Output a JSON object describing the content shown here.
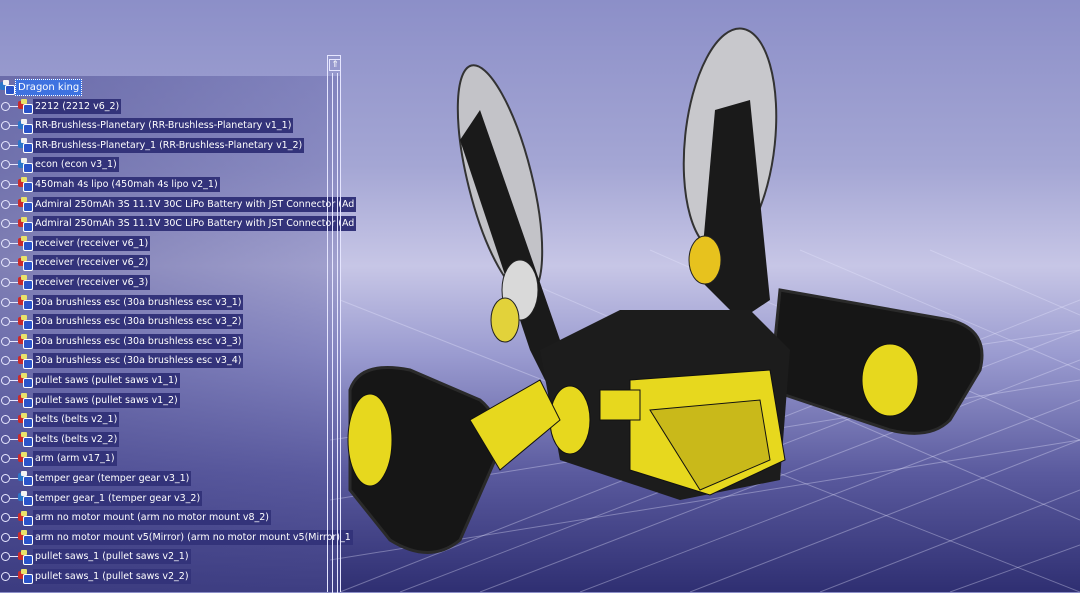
{
  "tree": {
    "root": {
      "label": "Dragon king"
    },
    "items": [
      {
        "label": "2212 (2212 v6_2)",
        "icon": "part-icon"
      },
      {
        "label": "RR-Brushless-Planetary (RR-Brushless-Planetary v1_1)",
        "icon": "product-icon"
      },
      {
        "label": "RR-Brushless-Planetary_1 (RR-Brushless-Planetary v1_2)",
        "icon": "product-icon"
      },
      {
        "label": "econ (econ v3_1)",
        "icon": "product-icon"
      },
      {
        "label": "450mah 4s lipo (450mah 4s lipo v2_1)",
        "icon": "part-icon"
      },
      {
        "label": "Admiral 250mAh 3S 11.1V 30C LiPo Battery with JST Connector (Ad",
        "icon": "part-icon"
      },
      {
        "label": "Admiral 250mAh 3S 11.1V 30C LiPo Battery with JST Connector (Ad",
        "icon": "part-icon"
      },
      {
        "label": "receiver (receiver v6_1)",
        "icon": "part-icon"
      },
      {
        "label": "receiver (receiver v6_2)",
        "icon": "part-icon"
      },
      {
        "label": "receiver (receiver v6_3)",
        "icon": "part-icon"
      },
      {
        "label": "30a brushless esc (30a brushless esc v3_1)",
        "icon": "part-icon"
      },
      {
        "label": "30a brushless esc (30a brushless esc v3_2)",
        "icon": "part-icon"
      },
      {
        "label": "30a brushless esc (30a brushless esc v3_3)",
        "icon": "part-icon"
      },
      {
        "label": "30a brushless esc (30a brushless esc v3_4)",
        "icon": "part-icon"
      },
      {
        "label": "pullet saws (pullet saws v1_1)",
        "icon": "part-icon"
      },
      {
        "label": "pullet saws (pullet saws v1_2)",
        "icon": "part-icon"
      },
      {
        "label": "belts (belts v2_1)",
        "icon": "part-icon"
      },
      {
        "label": "belts (belts v2_2)",
        "icon": "part-icon"
      },
      {
        "label": "arm (arm v17_1)",
        "icon": "part-icon"
      },
      {
        "label": "temper gear (temper gear v3_1)",
        "icon": "product-icon"
      },
      {
        "label": "temper gear_1 (temper gear v3_2)",
        "icon": "product-icon"
      },
      {
        "label": "arm no motor mount (arm no motor mount v8_2)",
        "icon": "part-icon"
      },
      {
        "label": "arm no motor mount v5(Mirror) (arm no motor mount v5(Mirror)_1",
        "icon": "part-icon"
      },
      {
        "label": "pullet saws_1 (pullet saws v2_1)",
        "icon": "part-icon"
      },
      {
        "label": "pullet saws_1 (pullet saws v2_2)",
        "icon": "part-icon"
      }
    ]
  },
  "scrollbar": {
    "arrow": "⇑"
  },
  "colors": {
    "body_yellow": "#e7d81e",
    "track_black": "#161616",
    "disc_grey": "#b8b8bc"
  }
}
